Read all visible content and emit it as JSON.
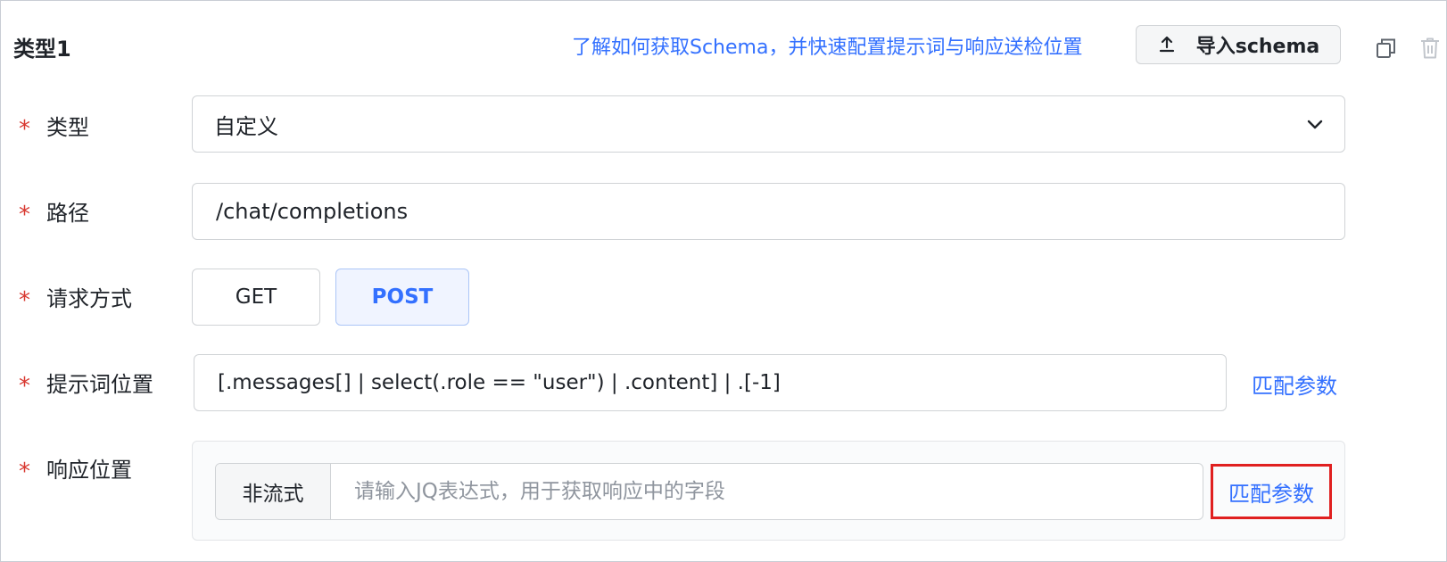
{
  "header": {
    "title": "类型1",
    "help_link": "了解如何获取Schema，并快速配置提示词与响应送检位置",
    "import_button": "导入schema",
    "icons": {
      "upload": "upload-icon",
      "copy": "copy-icon",
      "delete": "trash-icon"
    }
  },
  "form": {
    "required_mark": "*",
    "type": {
      "label": "类型",
      "value": "自定义"
    },
    "path": {
      "label": "路径",
      "value": "/chat/completions"
    },
    "method": {
      "label": "请求方式",
      "options": [
        "GET",
        "POST"
      ],
      "selected": "POST"
    },
    "prompt_position": {
      "label": "提示词位置",
      "value": "[.messages[] | select(.role == \"user\") | .content] | .[-1]",
      "match_link": "匹配参数"
    },
    "response_position": {
      "label": "响应位置",
      "mode": "非流式",
      "placeholder": "请输入JQ表达式，用于获取响应中的字段",
      "match_link": "匹配参数"
    }
  },
  "colors": {
    "accent": "#3370ff",
    "required": "#d83931",
    "highlight_border": "#e02020",
    "selected_bg": "#f0f4ff"
  }
}
